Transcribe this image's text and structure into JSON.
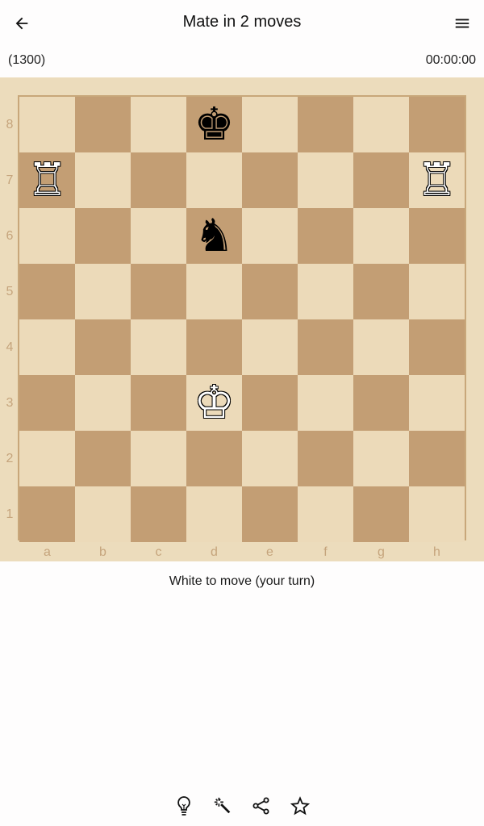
{
  "header": {
    "title": "Mate in 2 moves",
    "back_icon": "arrow-left-icon",
    "menu_icon": "hamburger-menu-icon"
  },
  "info": {
    "rating": "(1300)",
    "timer": "00:00:00"
  },
  "board": {
    "ranks": [
      "8",
      "7",
      "6",
      "5",
      "4",
      "3",
      "2",
      "1"
    ],
    "files": [
      "a",
      "b",
      "c",
      "d",
      "e",
      "f",
      "g",
      "h"
    ],
    "colors": {
      "light": "#ecdab9",
      "dark": "#c39e74",
      "frame": "#ecdcbc",
      "label": "#c5a47c"
    },
    "pieces": [
      {
        "square": "d8",
        "color": "black",
        "type": "king",
        "glyph": "♚"
      },
      {
        "square": "a7",
        "color": "white",
        "type": "rook",
        "glyph": "♖"
      },
      {
        "square": "h7",
        "color": "white",
        "type": "rook",
        "glyph": "♖"
      },
      {
        "square": "d6",
        "color": "black",
        "type": "knight",
        "glyph": "♞"
      },
      {
        "square": "d3",
        "color": "white",
        "type": "king",
        "glyph": "♔"
      }
    ]
  },
  "status": "White to move (your turn)",
  "toolbar": [
    {
      "name": "hint",
      "icon": "lightbulb-icon"
    },
    {
      "name": "solve",
      "icon": "magic-wand-icon"
    },
    {
      "name": "share",
      "icon": "share-icon"
    },
    {
      "name": "favorite",
      "icon": "star-icon"
    }
  ]
}
